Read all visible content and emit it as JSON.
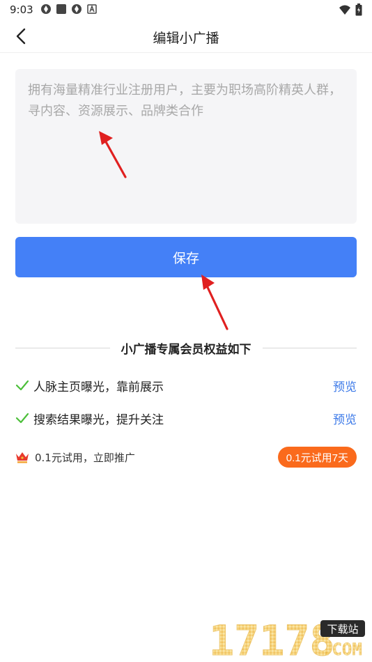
{
  "status_bar": {
    "time": "9:03",
    "icons_left": [
      "aperture-icon",
      "square-icon",
      "aperture-icon",
      "letter-a-icon"
    ],
    "icons_right": [
      "wifi-icon",
      "battery-icon"
    ]
  },
  "nav": {
    "title": "编辑小广播",
    "back_icon": "chevron-left-icon"
  },
  "editor": {
    "placeholder": "拥有海量精准行业注册用户，主要为职场高阶精英人群，寻内容、资源展示、品牌类合作",
    "value": ""
  },
  "save_button": {
    "label": "保存",
    "color": "#4480f7"
  },
  "benefits": {
    "heading": "小广播专属会员权益如下",
    "items": [
      {
        "text": "人脉主页曝光，靠前展示",
        "action": "预览"
      },
      {
        "text": "搜索结果曝光，提升关注",
        "action": "预览"
      }
    ],
    "check_color": "#4cbf3a"
  },
  "trial": {
    "icon": "crown-icon",
    "text": "0.1元试用，立即推广",
    "button_label": "0.1元试用7天",
    "button_color": "#fa6a1c"
  },
  "watermark": {
    "number": "17178",
    "tag": "下载站",
    "domain": ".COM"
  },
  "annotation_color": "#e02020"
}
